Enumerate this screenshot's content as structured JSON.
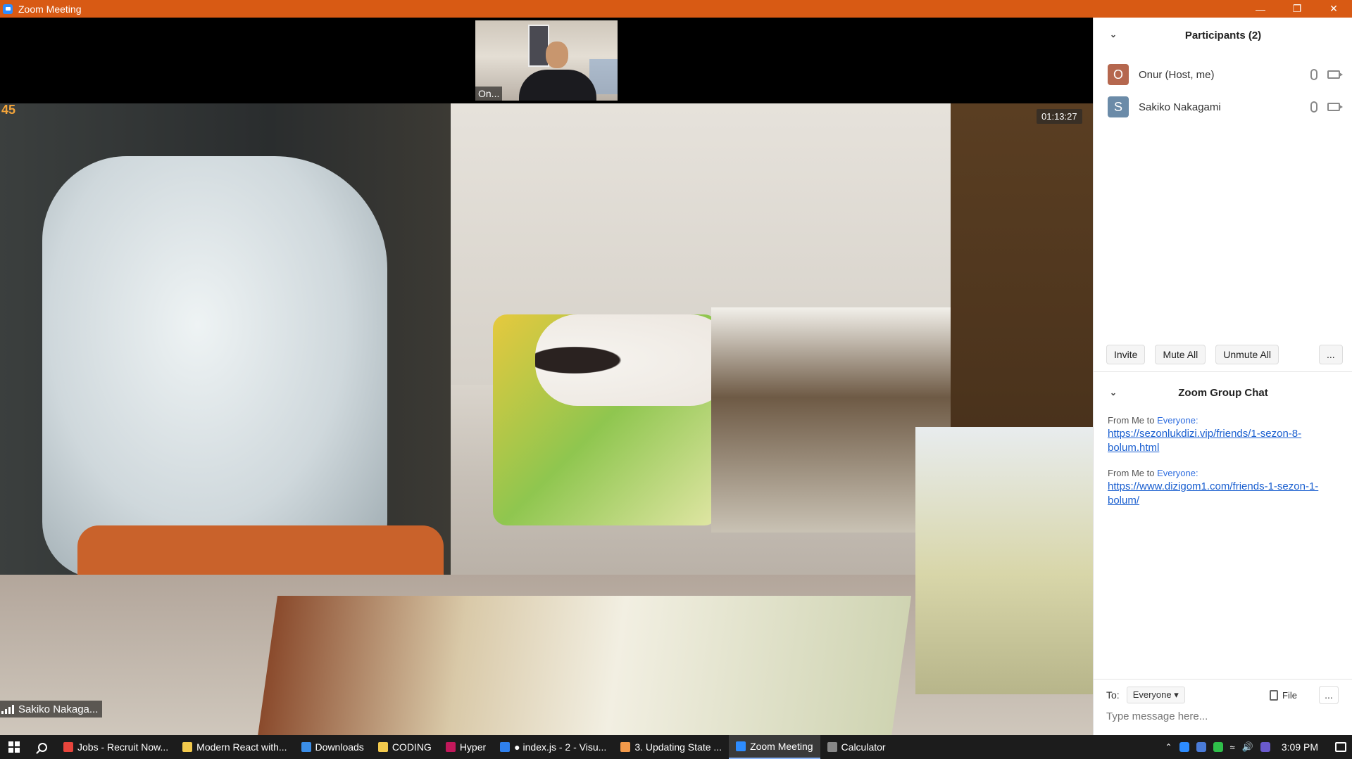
{
  "window": {
    "title": "Zoom Meeting"
  },
  "thumbnail": {
    "name": "On..."
  },
  "video": {
    "counter": "45",
    "timer": "01:13:27",
    "speaker_name": "Sakiko Nakaga..."
  },
  "participants": {
    "header": "Participants (2)",
    "list": [
      {
        "initial": "O",
        "name": "Onur (Host, me)",
        "color": "#b5674e"
      },
      {
        "initial": "S",
        "name": "Sakiko Nakagami",
        "color": "#6b8ba8"
      }
    ],
    "actions": {
      "invite": "Invite",
      "mute_all": "Mute All",
      "unmute_all": "Unmute All",
      "more": "..."
    }
  },
  "chat": {
    "header": "Zoom Group Chat",
    "messages": [
      {
        "from": "From Me to ",
        "to": "Everyone:",
        "link": "https://sezonlukdizi.vip/friends/1-sezon-8-bolum.html"
      },
      {
        "from": "From Me to ",
        "to": "Everyone:",
        "link": "https://www.dizigom1.com/friends-1-sezon-1-bolum/"
      }
    ],
    "to_label": "To:",
    "to_value": "Everyone",
    "file_label": "File",
    "more": "...",
    "placeholder": "Type message here..."
  },
  "taskbar": {
    "items": [
      {
        "label": "Jobs - Recruit Now...",
        "color": "#e8453c"
      },
      {
        "label": "Modern React with...",
        "color": "#f2c94c"
      },
      {
        "label": "Downloads",
        "color": "#3b8ee8"
      },
      {
        "label": "CODING",
        "color": "#f2c94c"
      },
      {
        "label": "Hyper",
        "color": "#c2185b"
      },
      {
        "label": "● index.js - 2 - Visu...",
        "color": "#2f80ed"
      },
      {
        "label": "3. Updating State ...",
        "color": "#f2994a"
      },
      {
        "label": "Zoom Meeting",
        "color": "#2d8cff"
      },
      {
        "label": "Calculator",
        "color": "#888888"
      }
    ],
    "clock": "3:09 PM"
  }
}
